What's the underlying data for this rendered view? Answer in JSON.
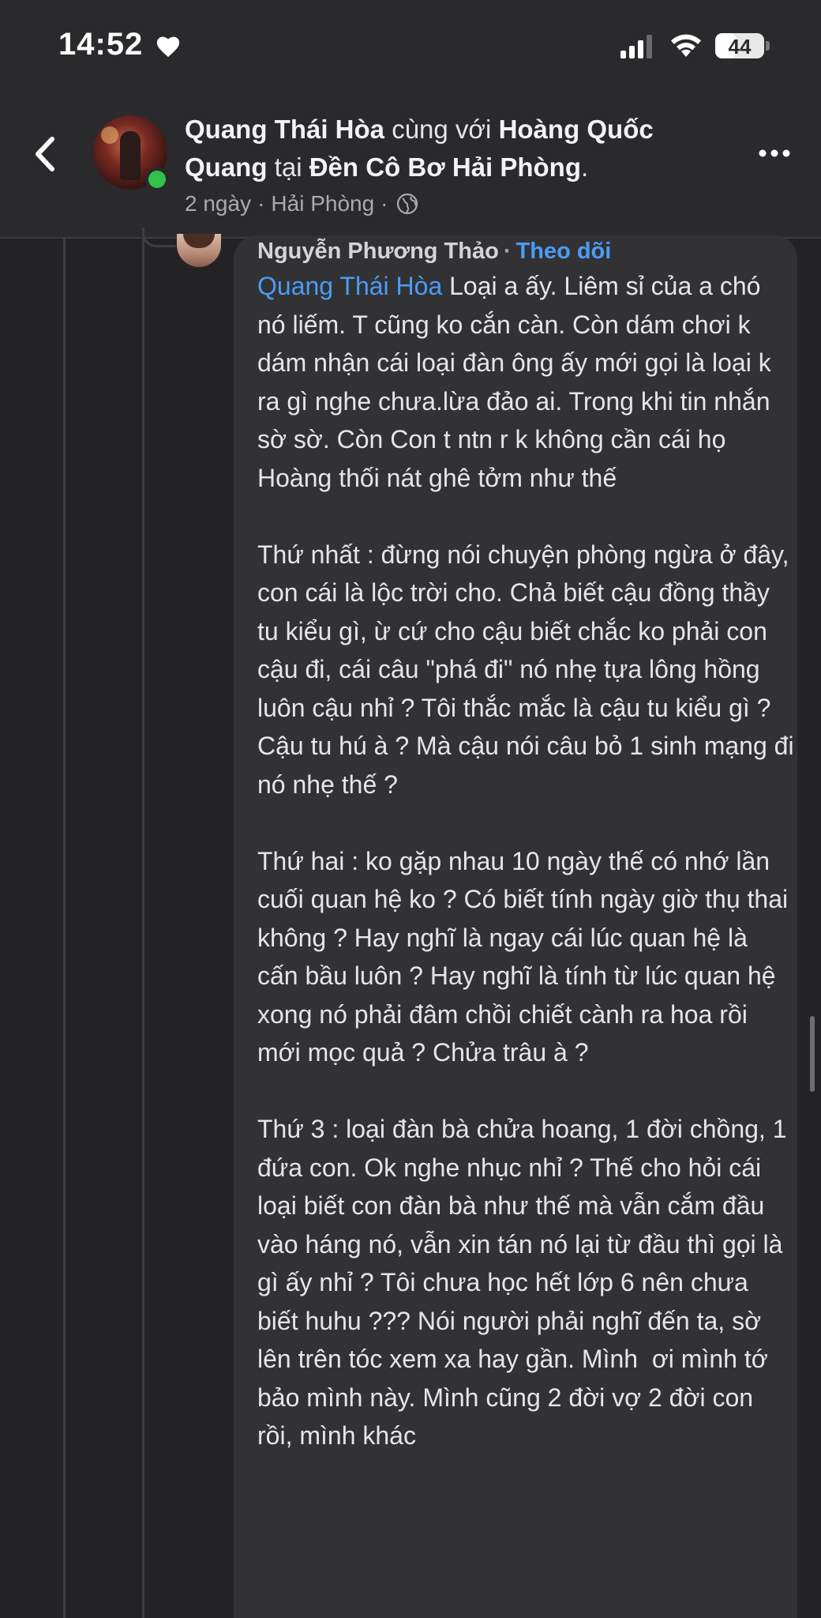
{
  "status_bar": {
    "time": "14:52",
    "battery": "44",
    "battery_level": 0.44
  },
  "header": {
    "author": "Quang Thái Hòa",
    "with_word": "cùng với",
    "tagged": "Hoàng Quốc Quang",
    "at_word": "tại",
    "place": "Đền Cô Bơ Hải Phòng",
    "time_ago": "2 ngày",
    "location": "Hải Phòng",
    "separator": "·"
  },
  "comment": {
    "author": "Nguyễn Phương Thảo",
    "follow_label": "Theo dõi",
    "mention": "Quang Thái Hòa",
    "body": " Loại a ấy. Liêm sỉ của a chó nó liếm. T cũng ko cắn càn. Còn dám chơi k dám nhận cái loại đàn ông ấy mới gọi là loại k ra gì nghe chưa.lừa đảo ai. Trong khi tin nhắn sờ sờ. Còn Con t ntn r k không cần cái họ Hoàng thối nát ghê tởm như thế\n\nThứ nhất : đừng nói chuyện phòng ngừa ở đây, con cái là lộc trời cho. Chả biết cậu đồng thầy tu kiểu gì, ừ cứ cho cậu biết chắc ko phải con cậu đi, cái câu \"phá đi\" nó nhẹ tựa lông hồng luôn cậu nhỉ ? Tôi thắc mắc là cậu tu kiểu gì ? Cậu tu hú à ? Mà cậu nói câu bỏ 1 sinh mạng đi nó nhẹ thế ?\n\nThứ hai : ko gặp nhau 10 ngày thế có nhớ lần cuối quan hệ ko ? Có biết tính ngày giờ thụ thai không ? Hay nghĩ là ngay cái lúc quan hệ là cấn bầu luôn ? Hay nghĩ là tính từ lúc quan hệ xong nó phải đâm chồi chiết cành ra hoa rồi mới mọc quả ? Chửa trâu à ?\n\nThứ 3 : loại đàn bà chửa hoang, 1 đời chồng, 1 đứa con. Ok nghe nhục nhỉ ? Thế cho hỏi cái loại biết con đàn bà như thế mà vẫn cắm đầu vào háng nó, vẫn xin tán nó lại từ đầu thì gọi là gì ấy nhỉ ? Tôi chưa học hết lớp 6 nên chưa biết huhu ??? Nói người phải nghĩ đến ta, sờ lên trên tóc xem xa hay gần. Mình  ơi mình tớ bảo mình này. Mình cũng 2 đời vợ 2 đời con rồi, mình khác"
  },
  "icons": {
    "heart": "heart-icon",
    "signal": "cellular-signal-icon",
    "wifi": "wifi-icon",
    "back": "chevron-left-icon",
    "globe": "globe-icon",
    "more": "more-horizontal-icon"
  },
  "colors": {
    "background": "#232325",
    "bubble": "#323234",
    "link": "#4b9cf5",
    "online": "#31c24a"
  }
}
